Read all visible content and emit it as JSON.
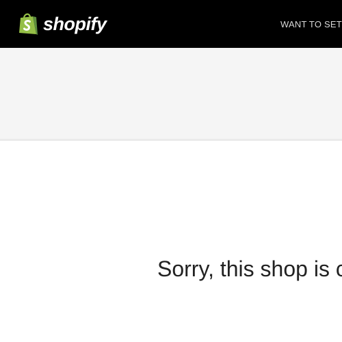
{
  "header": {
    "brand_name": "shopify",
    "logo_icon": "shopping-bag-icon",
    "nav_link": "WANT TO SETU"
  },
  "main": {
    "message": "Sorry, this shop is c"
  },
  "colors": {
    "header_bg": "#000000",
    "brand_green": "#95BF47",
    "band_bg": "#F5F5F5",
    "text_dark": "#222222"
  }
}
